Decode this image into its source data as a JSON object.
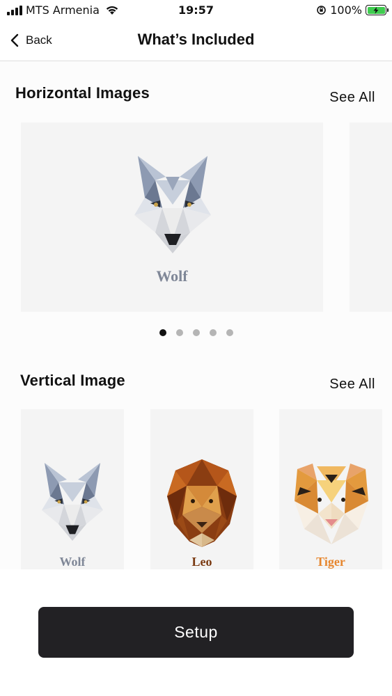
{
  "status_bar": {
    "carrier": "MTS Armenia",
    "time": "19:57",
    "battery_percent": "100%"
  },
  "nav": {
    "back_label": "Back",
    "title": "What’s Included"
  },
  "horizontal": {
    "title": "Horizontal Images",
    "see_all": "See All",
    "cards": [
      {
        "label": "Wolf",
        "icon": "wolf-image"
      }
    ],
    "pages": 5,
    "active_page": 1
  },
  "vertical": {
    "title": "Vertical Image",
    "see_all": "See All",
    "cards": [
      {
        "label": "Wolf",
        "icon": "wolf-image",
        "label_color": "#7f8797"
      },
      {
        "label": "Leo",
        "icon": "lion-image",
        "label_color": "#7a3a12"
      },
      {
        "label": "Tiger",
        "icon": "tiger-image",
        "label_color": "#e6862e"
      }
    ]
  },
  "setup_button": "Setup",
  "colors": {
    "button_bg": "#222124",
    "card_bg": "#f4f4f4",
    "battery": "#3fcc4f",
    "wolf_label": "#7f8797"
  }
}
